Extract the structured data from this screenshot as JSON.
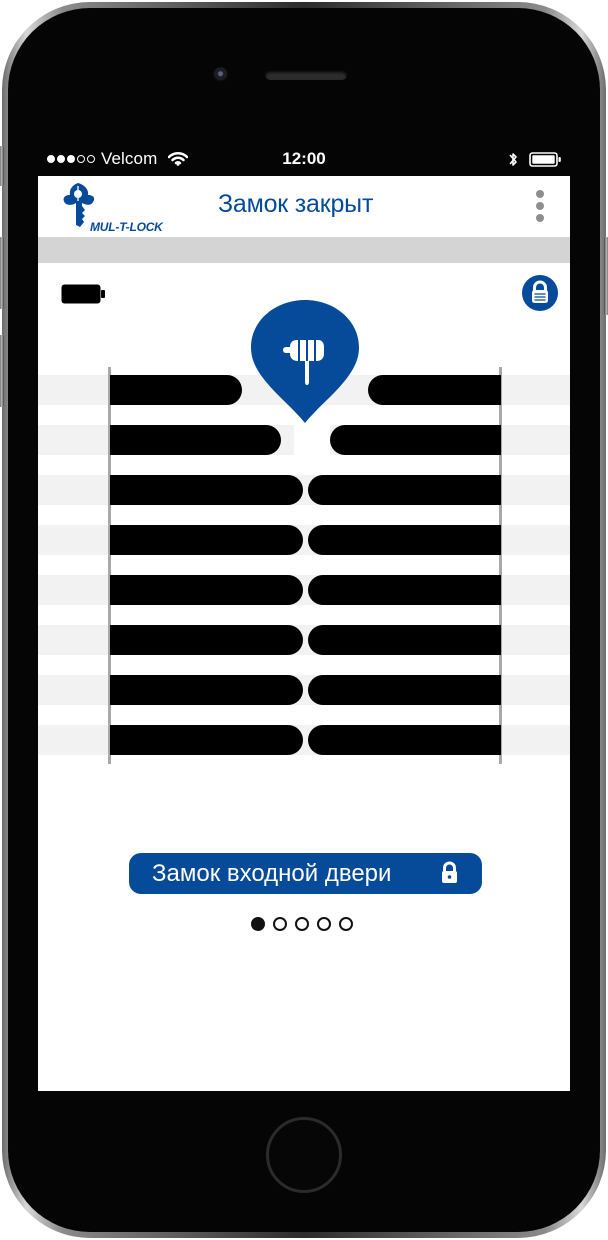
{
  "status_bar": {
    "carrier": "Velcom",
    "time": "12:00"
  },
  "header": {
    "logo_text": "MUL-T-LOCK",
    "title": "Замок закрыт"
  },
  "lock_panel": {
    "lock_button_label": "Замок входной двери",
    "page_count": 5,
    "active_page": 1
  },
  "colors": {
    "brand_blue": "#064b99",
    "pin_black": "#000000",
    "stripe_gray": "#f2f2f2",
    "header_strip": "#d4d4d4"
  },
  "icons": {
    "more": "vertical-dots-icon",
    "battery": "battery-icon",
    "lock": "lock-icon",
    "touch": "pointing-hand-icon"
  }
}
